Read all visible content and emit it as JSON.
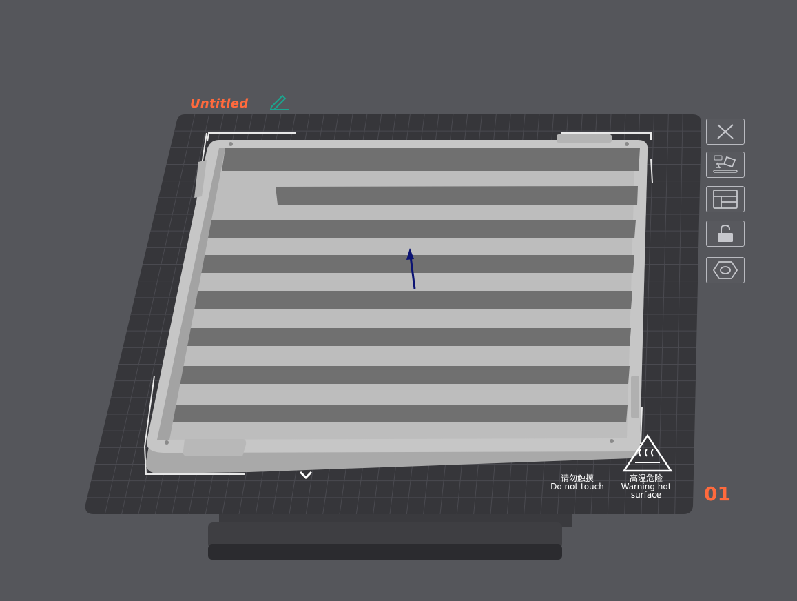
{
  "plate": {
    "title": "Untitled",
    "number": "01",
    "warnings": {
      "touch_cn": "请勿触摸",
      "touch_en": "Do not touch",
      "hot_cn": "高温危险",
      "hot_en_line1": "Warning hot",
      "hot_en_line2": "surface"
    }
  },
  "toolbar": {
    "buttons": [
      {
        "name": "close-plate-icon"
      },
      {
        "name": "auto-orient-icon"
      },
      {
        "name": "arrange-icon"
      },
      {
        "name": "lock-icon"
      },
      {
        "name": "plate-settings-icon"
      }
    ]
  },
  "colors": {
    "background": "#55565b",
    "bed": "#36363a",
    "model": "#c4c4c4",
    "accent": "#ff6a3d",
    "edit_accent": "#1ba58f",
    "axis_arrow": "#0b1373"
  }
}
